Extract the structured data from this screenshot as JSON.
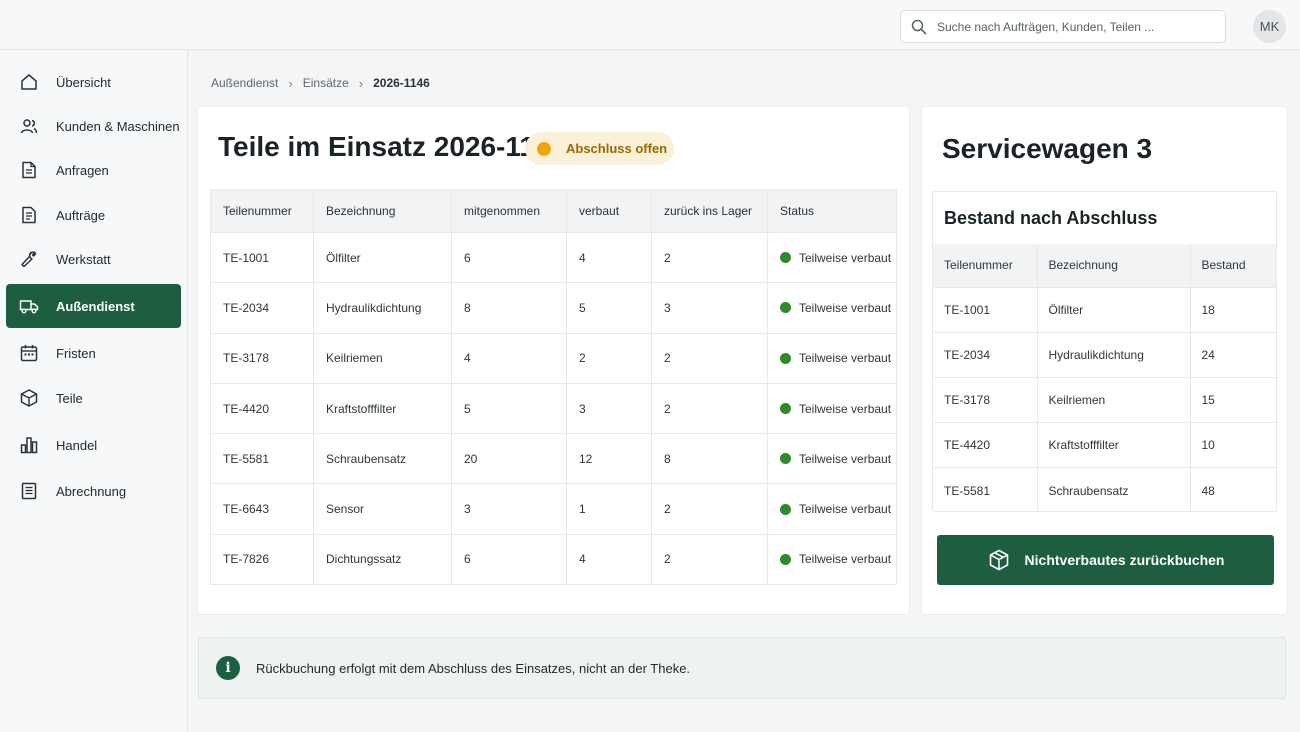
{
  "header": {
    "search_placeholder": "Suche nach Aufträgen, Kunden, Teilen ...",
    "avatar_initials": "MK"
  },
  "sidebar": {
    "items": [
      {
        "label": "Übersicht",
        "icon": "home-icon",
        "active": false
      },
      {
        "label": "Kunden & Maschinen",
        "icon": "users-icon",
        "active": false
      },
      {
        "label": "Anfragen",
        "icon": "document-icon",
        "active": false
      },
      {
        "label": "Aufträge",
        "icon": "document-list-icon",
        "active": false
      },
      {
        "label": "Werkstatt",
        "icon": "wrench-icon",
        "active": false
      },
      {
        "label": "Außendienst",
        "icon": "truck-icon",
        "active": true
      },
      {
        "label": "Fristen",
        "icon": "calendar-icon",
        "active": false
      },
      {
        "label": "Teile",
        "icon": "box-icon",
        "active": false
      },
      {
        "label": "Handel",
        "icon": "bar-chart-icon",
        "active": false
      },
      {
        "label": "Abrechnung",
        "icon": "invoice-icon",
        "active": false
      }
    ]
  },
  "breadcrumb": {
    "items": [
      "Außendienst",
      "Einsätze",
      "2026-1146"
    ]
  },
  "main": {
    "title": "Teile im Einsatz 2026-1146",
    "badge": "Abschluss offen",
    "columns": [
      "Teilenummer",
      "Bezeichnung",
      "mitgenommen",
      "verbaut",
      "zurück ins Lager",
      "Status"
    ],
    "rows": [
      {
        "nr": "TE-1001",
        "name": "Ölfilter",
        "taken": "6",
        "used": "4",
        "back": "2",
        "status": "Teilweise verbaut"
      },
      {
        "nr": "TE-2034",
        "name": "Hydraulikdichtung",
        "taken": "8",
        "used": "5",
        "back": "3",
        "status": "Teilweise verbaut"
      },
      {
        "nr": "TE-3178",
        "name": "Keilriemen",
        "taken": "4",
        "used": "2",
        "back": "2",
        "status": "Teilweise verbaut"
      },
      {
        "nr": "TE-4420",
        "name": "Kraftstofffilter",
        "taken": "5",
        "used": "3",
        "back": "2",
        "status": "Teilweise verbaut"
      },
      {
        "nr": "TE-5581",
        "name": "Schraubensatz",
        "taken": "20",
        "used": "12",
        "back": "8",
        "status": "Teilweise verbaut"
      },
      {
        "nr": "TE-6643",
        "name": "Sensor",
        "taken": "3",
        "used": "1",
        "back": "2",
        "status": "Teilweise verbaut"
      },
      {
        "nr": "TE-7826",
        "name": "Dichtungssatz",
        "taken": "6",
        "used": "4",
        "back": "2",
        "status": "Teilweise verbaut"
      }
    ]
  },
  "side": {
    "title": "Servicewagen 3",
    "subtitle": "Bestand nach Abschluss",
    "columns": [
      "Teilenummer",
      "Bezeichnung",
      "Bestand"
    ],
    "rows": [
      {
        "nr": "TE-1001",
        "name": "Ölfilter",
        "stock": "18"
      },
      {
        "nr": "TE-2034",
        "name": "Hydraulikdichtung",
        "stock": "24"
      },
      {
        "nr": "TE-3178",
        "name": "Keilriemen",
        "stock": "15"
      },
      {
        "nr": "TE-4420",
        "name": "Kraftstofffilter",
        "stock": "10"
      },
      {
        "nr": "TE-5581",
        "name": "Schraubensatz",
        "stock": "48"
      }
    ],
    "button_label": "Nichtverbautes zurückbuchen"
  },
  "info": {
    "message": "Rückbuchung erfolgt mit dem Abschluss des Einsatzes, nicht an der Theke."
  },
  "colors": {
    "accent": "#1d5e40",
    "badge_bg": "#fbf1d8",
    "badge_dot": "#f0a30a",
    "status_dot": "#2e8a2a"
  }
}
